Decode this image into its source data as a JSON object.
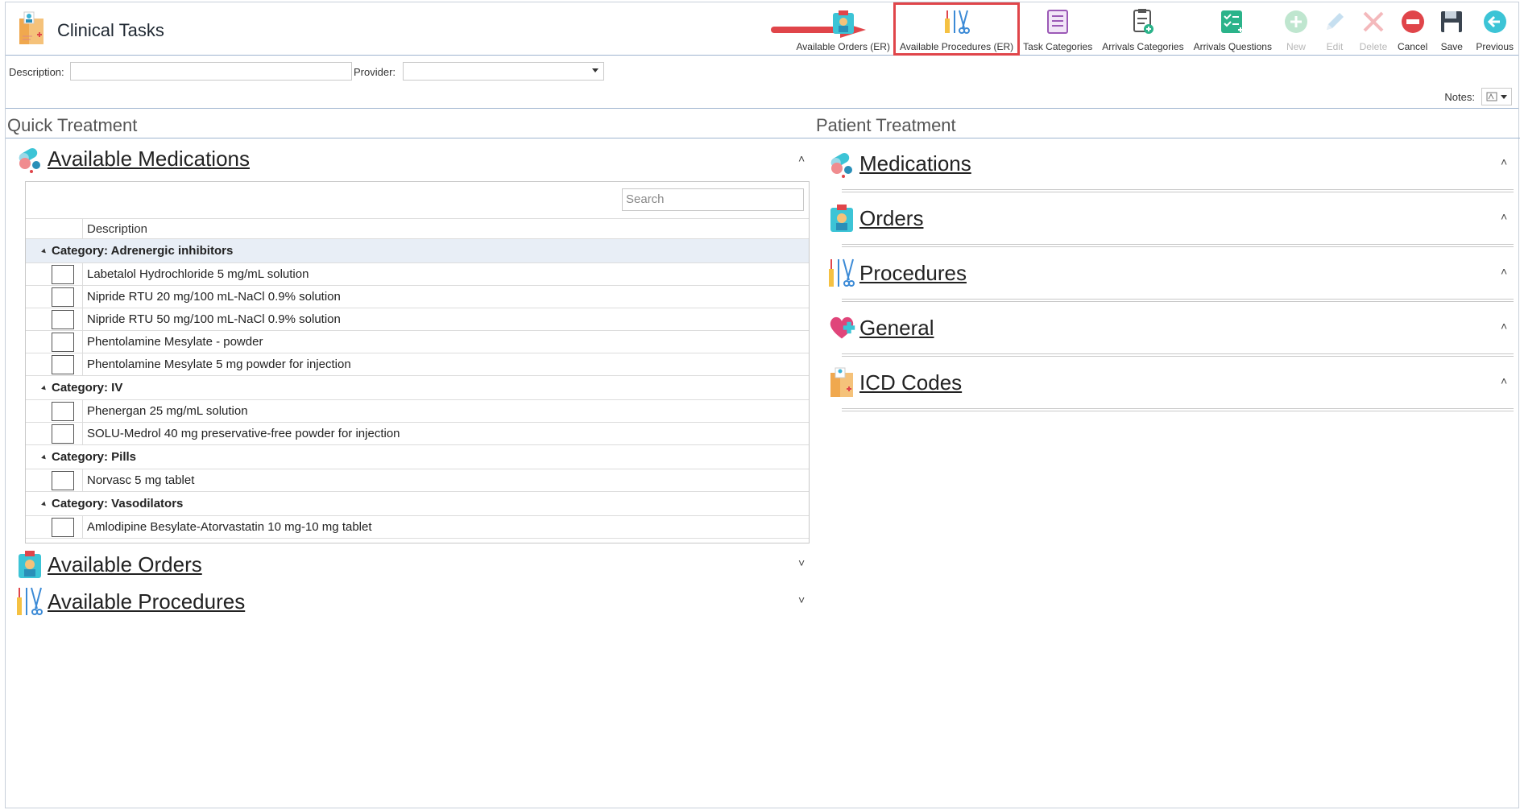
{
  "app": {
    "title": "Clinical Tasks",
    "icon": "clinical-tasks-icon"
  },
  "toolbar": {
    "buttons": [
      {
        "label": "Available Orders (ER)",
        "icon": "orders-icon",
        "enabled": true
      },
      {
        "label": "Available Procedures (ER)",
        "icon": "procedures-icon",
        "enabled": true,
        "highlighted": true
      },
      {
        "label": "Task Categories",
        "icon": "task-categories-icon",
        "enabled": true
      },
      {
        "label": "Arrivals Categories",
        "icon": "arrivals-categories-icon",
        "enabled": true
      },
      {
        "label": "Arrivals Questions",
        "icon": "arrivals-questions-icon",
        "enabled": true
      },
      {
        "label": "New",
        "icon": "plus-circle-icon",
        "enabled": false
      },
      {
        "label": "Edit",
        "icon": "pencil-icon",
        "enabled": false
      },
      {
        "label": "Delete",
        "icon": "x-icon",
        "enabled": false
      },
      {
        "label": "Cancel",
        "icon": "cancel-icon",
        "enabled": true
      },
      {
        "label": "Save",
        "icon": "save-icon",
        "enabled": true
      },
      {
        "label": "Previous",
        "icon": "arrow-left-icon",
        "enabled": true
      }
    ]
  },
  "filters": {
    "description_label": "Description:",
    "description_value": "",
    "provider_label": "Provider:",
    "provider_value": ""
  },
  "notes": {
    "label": "Notes:"
  },
  "quick_treatment": {
    "title": "Quick Treatment",
    "medications": {
      "title": "Available Medications",
      "search_placeholder": "Search",
      "column_header": "Description",
      "categories": [
        {
          "label": "Category: Adrenergic inhibitors",
          "items": [
            "Labetalol Hydrochloride 5 mg/mL solution",
            "Nipride RTU 20 mg/100 mL-NaCl 0.9% solution",
            "Nipride RTU 50 mg/100 mL-NaCl 0.9% solution",
            "Phentolamine Mesylate - powder",
            "Phentolamine Mesylate 5 mg powder for injection"
          ]
        },
        {
          "label": "Category: IV",
          "items": [
            "Phenergan 25 mg/mL solution",
            "SOLU-Medrol 40 mg preservative-free powder for injection"
          ]
        },
        {
          "label": "Category: Pills",
          "items": [
            "Norvasc 5 mg tablet"
          ]
        },
        {
          "label": "Category: Vasodilators",
          "items": [
            "Amlodipine Besylate-Atorvastatin 10 mg-10 mg tablet"
          ]
        }
      ]
    },
    "orders": {
      "title": "Available Orders"
    },
    "procedures": {
      "title": "Available Procedures"
    }
  },
  "patient_treatment": {
    "title": "Patient Treatment",
    "sections": [
      {
        "title": "Medications",
        "icon": "pills-icon"
      },
      {
        "title": "Orders",
        "icon": "orders-icon"
      },
      {
        "title": "Procedures",
        "icon": "procedures-icon"
      },
      {
        "title": "General",
        "icon": "heart-plus-icon"
      },
      {
        "title": "ICD Codes",
        "icon": "icd-codes-icon"
      }
    ]
  }
}
